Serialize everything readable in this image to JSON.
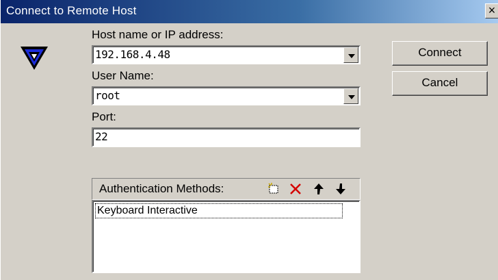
{
  "window": {
    "title": "Connect to Remote Host",
    "close_glyph": "×"
  },
  "form": {
    "host_label": "Host name or IP address:",
    "host_value": "192.168.4.48",
    "user_label": "User Name:",
    "user_value": "root",
    "port_label": "Port:",
    "port_value": "22"
  },
  "auth": {
    "label": "Authentication Methods:",
    "items": [
      "Keyboard Interactive"
    ],
    "tools": {
      "new": "new-item-icon",
      "delete": "delete-icon",
      "up": "arrow-up-icon",
      "down": "arrow-down-icon"
    }
  },
  "buttons": {
    "connect": "Connect",
    "cancel": "Cancel"
  },
  "colors": {
    "title_start": "#0a246a",
    "title_end": "#a6caf0",
    "delete_red": "#d40000",
    "face": "#d4d0c8"
  }
}
